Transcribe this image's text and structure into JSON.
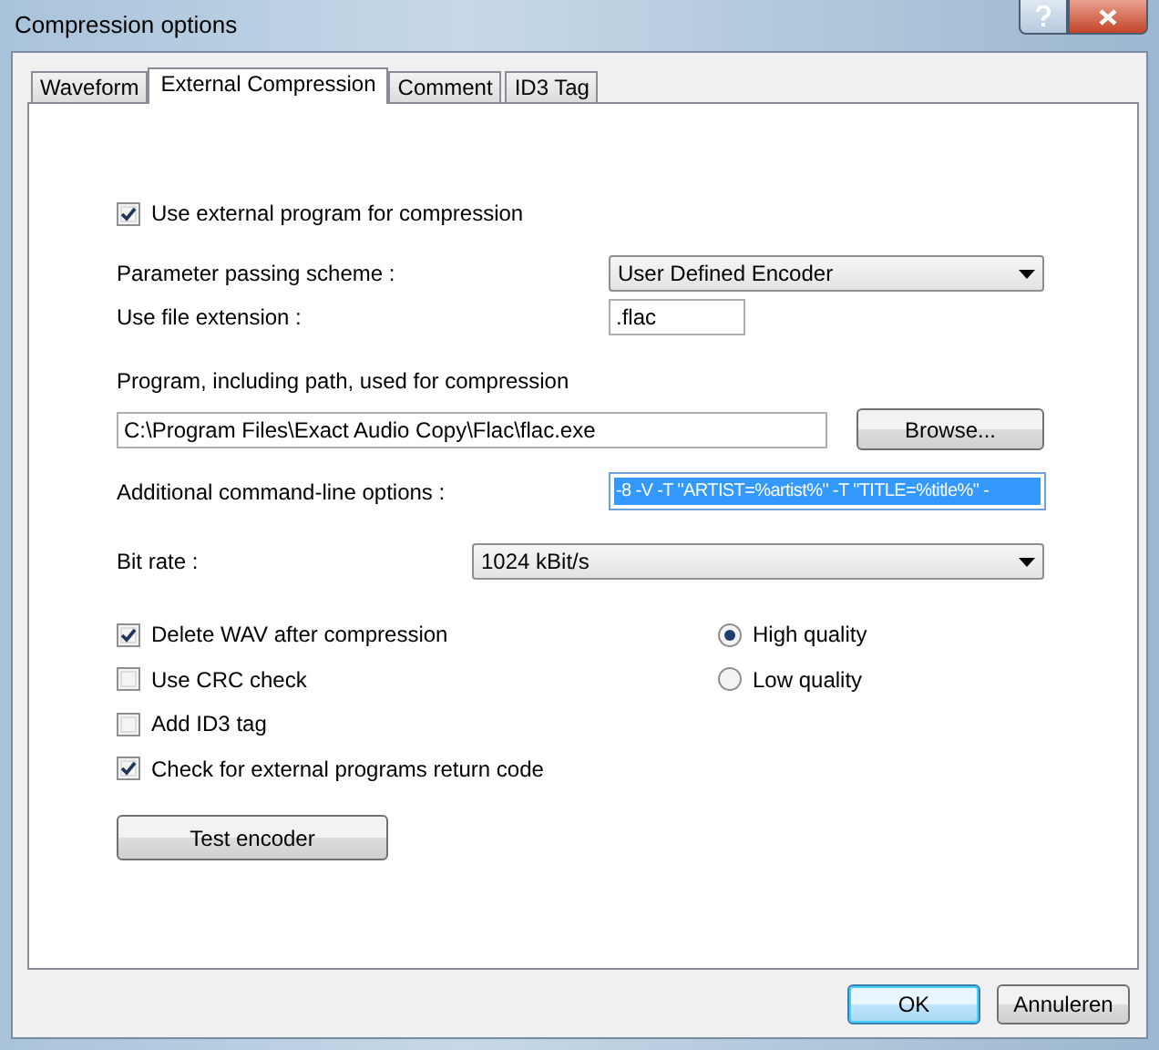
{
  "window": {
    "title": "Compression options"
  },
  "tabs": [
    {
      "label": "Waveform",
      "selected": false
    },
    {
      "label": "External Compression",
      "selected": true
    },
    {
      "label": "Comment",
      "selected": false
    },
    {
      "label": "ID3 Tag",
      "selected": false
    }
  ],
  "use_external": {
    "label": "Use external program for compression",
    "checked": true
  },
  "parameter_scheme": {
    "label": "Parameter passing scheme :",
    "value": "User Defined Encoder"
  },
  "file_extension": {
    "label": "Use file extension :",
    "value": ".flac"
  },
  "program": {
    "label": "Program, including path, used for compression",
    "value": "C:\\Program Files\\Exact Audio Copy\\Flac\\flac.exe",
    "button": "Browse..."
  },
  "options": {
    "label": "Additional command-line options :",
    "value": "-8 -V -T \"ARTIST=%artist%\" -T \"TITLE=%title%\" -"
  },
  "bit_rate": {
    "label": "Bit rate :",
    "value": "1024 kBit/s"
  },
  "checkboxes": [
    {
      "label": "Delete WAV after compression",
      "checked": true
    },
    {
      "label": "Use CRC check",
      "checked": false
    },
    {
      "label": "Add ID3 tag",
      "checked": false
    },
    {
      "label": "Check for external programs return code",
      "checked": true
    }
  ],
  "quality": [
    {
      "label": "High quality",
      "selected": true
    },
    {
      "label": "Low quality",
      "selected": false
    }
  ],
  "test_button": "Test encoder",
  "buttons": [
    {
      "label": "OK",
      "kind": "default"
    },
    {
      "label": "Annuleren",
      "kind": "normal"
    }
  ]
}
